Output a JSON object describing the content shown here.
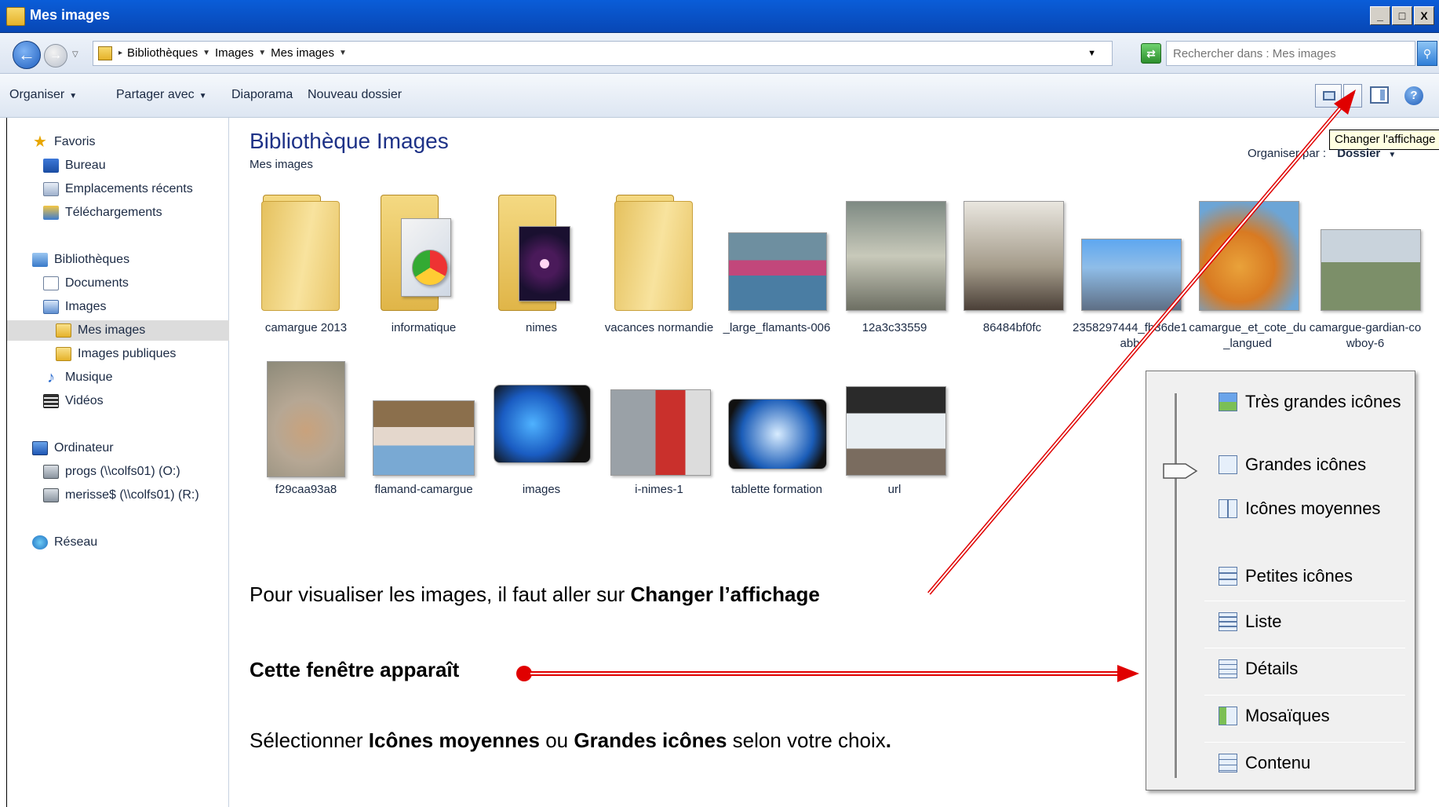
{
  "window": {
    "title": "Mes images",
    "controls": [
      "_",
      "□",
      "X"
    ]
  },
  "address": {
    "crumbs": [
      "Bibliothèques",
      "Images",
      "Mes images"
    ],
    "search_placeholder": "Rechercher dans : Mes images"
  },
  "toolbar": {
    "organise": "Organiser",
    "share": "Partager avec",
    "slideshow": "Diaporama",
    "new_folder": "Nouveau dossier",
    "tooltip": "Changer l'affichage"
  },
  "nav": {
    "favorites": "Favoris",
    "desktop": "Bureau",
    "recent": "Emplacements récents",
    "downloads": "Téléchargements",
    "libraries": "Bibliothèques",
    "documents": "Documents",
    "images": "Images",
    "my_images": "Mes images",
    "public_images": "Images publiques",
    "music": "Musique",
    "videos": "Vidéos",
    "computer": "Ordinateur",
    "drive_o": "progs (\\\\colfs01) (O:)",
    "drive_r": "merisse$ (\\\\colfs01) (R:)",
    "network": "Réseau"
  },
  "content": {
    "title": "Bibliothèque Images",
    "subtitle": "Mes images",
    "arrange_label": "Organiser par :",
    "arrange_value": "Dossier",
    "items": [
      "camargue 2013",
      "informatique",
      "nimes",
      "vacances normandie",
      "_large_flamants-006",
      "12a3c33559",
      "86484bf0fc",
      "2358297444_fb36de1abb",
      "camargue_et_cote_du_langued",
      "camargue-gardian-cowboy-6",
      "f29caa93a8",
      "flamand-camargue",
      "images",
      "i-nimes-1",
      "tablette formation",
      "url"
    ]
  },
  "instructions": {
    "line1_prefix": "Pour visualiser les images, il faut aller sur ",
    "line1_bold": "Changer l’affichage",
    "line2_bold": "Cette fenêtre apparaît",
    "line3_prefix": "Sélectionner ",
    "line3_bold1": "Icônes moyennes",
    "line3_mid": " ou ",
    "line3_bold2": "Grandes icônes",
    "line3_suffix": " selon votre choix",
    "line3_end": "."
  },
  "view_menu": {
    "extra_large": "Très grandes icônes",
    "large": "Grandes icônes",
    "medium": "Icônes moyennes",
    "small": "Petites icônes",
    "list": "Liste",
    "details": "Détails",
    "tiles": "Mosaïques",
    "content": "Contenu",
    "selected": "Grandes icônes"
  },
  "colors": {
    "annotation": "#e00000",
    "title_bar": "#0a5dd8",
    "library_title": "#1e3287"
  }
}
